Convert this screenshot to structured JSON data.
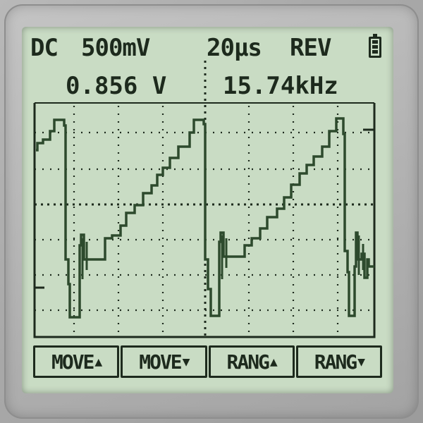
{
  "status_bar": {
    "coupling": "DC",
    "volts_div": "500mV",
    "time_div": "20μs",
    "mode": "REV",
    "battery_icon": "battery-icon"
  },
  "measurements": {
    "voltage": "0.856 V",
    "frequency": "15.74kHz"
  },
  "softkeys": [
    {
      "label": "MOVE",
      "arrow": "▲"
    },
    {
      "label": "MOVE",
      "arrow": "▼"
    },
    {
      "label": "RANG",
      "arrow": "▲"
    },
    {
      "label": "RANG",
      "arrow": "▼"
    }
  ],
  "colors": {
    "lcd_background": "#c9dcc4",
    "lcd_ink": "#1d2a1d",
    "trace": "#2d4a2d"
  }
}
